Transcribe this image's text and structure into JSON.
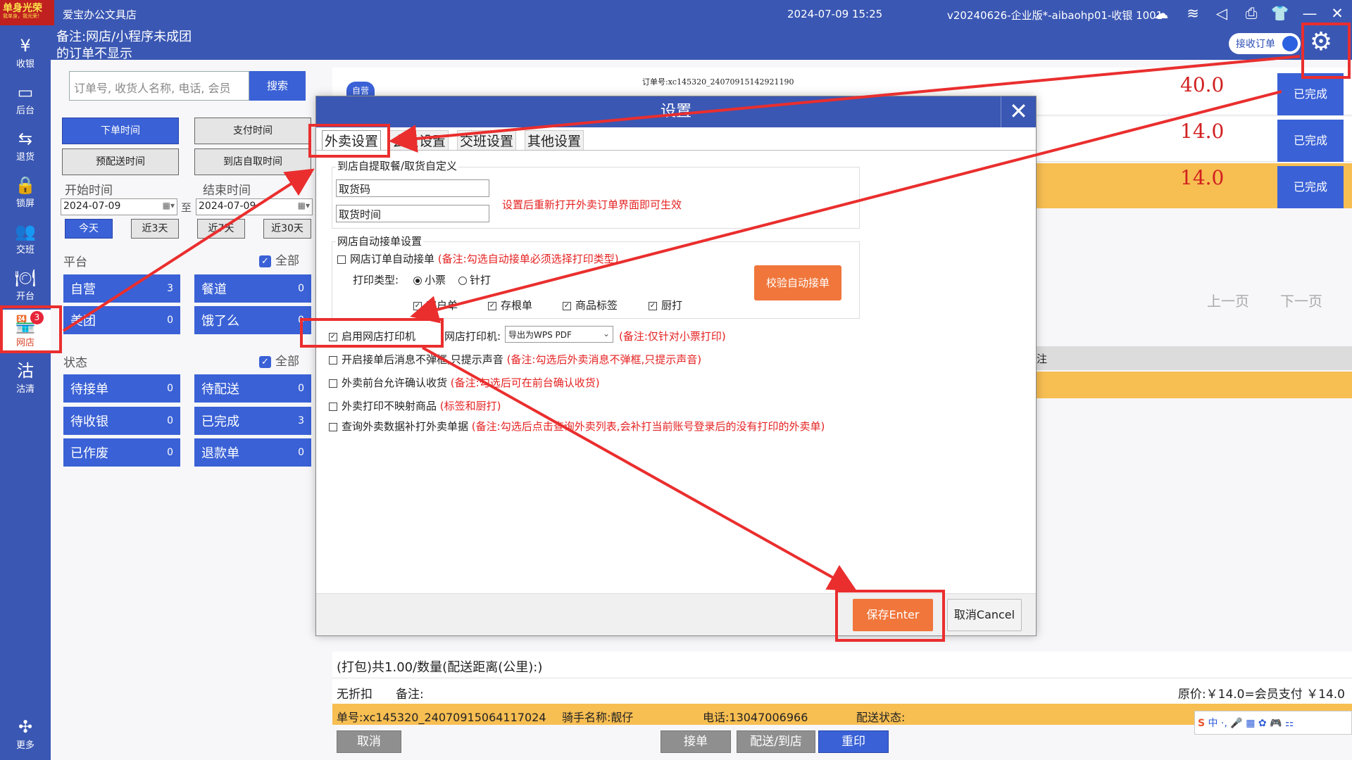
{
  "topbar": {
    "logo_main": "单身光荣",
    "logo_sub": "我单身，我光荣！",
    "store_name": "爱宝办公文具店",
    "datetime": "2024-07-09 15:25",
    "version": "v20240626-企业版*-aibaohp01-收银 1001",
    "note_line1": "备注:网店/小程序未成团",
    "note_line2": "的订单不显示",
    "toggle_label": "接收订单",
    "icons": [
      "cloud-icon",
      "wifi-icon",
      "speaker-icon",
      "printer-icon",
      "shirt-icon",
      "minimize-icon",
      "close-icon"
    ]
  },
  "sidebar": {
    "items": [
      {
        "label": "收银",
        "icon": "¥"
      },
      {
        "label": "后台",
        "icon": "▭"
      },
      {
        "label": "退货",
        "icon": "⇆"
      },
      {
        "label": "锁屏",
        "icon": "🔒"
      },
      {
        "label": "交班",
        "icon": "👥"
      },
      {
        "label": "开台",
        "icon": "🍽"
      },
      {
        "label": "网店",
        "icon": "🏪",
        "badge": "3"
      },
      {
        "label": "沽清",
        "icon": "沽"
      },
      {
        "label": "更多",
        "icon": "✣"
      }
    ]
  },
  "filters": {
    "search_placeholder": "订单号, 收货人名称, 电话, 会员",
    "search_button": "搜索",
    "time_buttons": [
      "下单时间",
      "支付时间",
      "预配送时间",
      "到店自取时间"
    ],
    "start_label": "开始时间",
    "end_label": "结束时间",
    "start_date": "2024-07-09",
    "to_label": "至",
    "end_date": "2024-07-09",
    "quick_ranges": [
      "今天",
      "近3天",
      "近7天",
      "近30天"
    ],
    "platform_label": "平台",
    "all_label": "全部",
    "platforms": [
      {
        "name": "自营",
        "count": "3"
      },
      {
        "name": "餐道",
        "count": "0"
      },
      {
        "name": "美团",
        "count": "0"
      },
      {
        "name": "饿了么",
        "count": "0"
      }
    ],
    "status_label": "状态",
    "statuses": [
      {
        "name": "待接单",
        "count": "0"
      },
      {
        "name": "待配送",
        "count": "0"
      },
      {
        "name": "待收银",
        "count": "0"
      },
      {
        "name": "已完成",
        "count": "3"
      },
      {
        "name": "已作废",
        "count": "0"
      },
      {
        "name": "退款单",
        "count": "0"
      }
    ]
  },
  "orders": {
    "first_order_no": "订单号:xc145320_24070915142921190",
    "first_tag": "自营",
    "rows": [
      {
        "price": "40.0",
        "status": "已完成"
      },
      {
        "price": "14.0",
        "status": "已完成"
      },
      {
        "price": "14.0",
        "status": "已完成"
      }
    ],
    "prev_page": "上一页",
    "next_page": "下一页",
    "col_fragment": "注"
  },
  "modal": {
    "title": "设置",
    "tabs": [
      "外卖设置",
      "会员设置",
      "交班设置",
      "其他设置"
    ],
    "pickup_group": "到店自提取餐/取货自定义",
    "pickup_code": "取货码",
    "pickup_time": "取货时间",
    "pickup_hint": "设置后重新打开外卖订单界面即可生效",
    "auto_group": "网店自动接单设置",
    "auto_accept": "网店订单自动接单",
    "auto_accept_note": "(备注:勾选自动接单必须选择打印类型)",
    "print_type_label": "打印类型:",
    "print_type_receipt": "小票",
    "print_type_dot": "针打",
    "receipt_options": [
      "客户单",
      "存根单",
      "商品标签",
      "厨打"
    ],
    "verify_button": "校验自动接单",
    "enable_printer": "启用网店打印机",
    "printer_label": "网店打印机:",
    "printer_value": "导出为WPS PDF",
    "printer_note": "(备注:仅针对小票打印)",
    "options": [
      {
        "label": "开启接单后消息不弹框,只提示声音",
        "note": "(备注:勾选后外卖消息不弹框,只提示声音)"
      },
      {
        "label": "外卖前台允许确认收货",
        "note": "(备注:勾选后可在前台确认收货)"
      },
      {
        "label": "外卖打印不映射商品",
        "note": "(标签和厨打)"
      },
      {
        "label": "查询外卖数据补打外卖单据",
        "note": "(备注:勾选后点击查询外卖列表,会补打当前账号登录后的没有打印的外卖单)"
      }
    ],
    "save_button": "保存Enter",
    "cancel_button": "取消Cancel"
  },
  "detail": {
    "pack_line": "(打包)共1.00/数量(配送距离(公里):)",
    "discount": "无折扣",
    "remark_label": "备注:",
    "price_line": "原价:￥14.0=会员支付 ￥14.0",
    "order_no": "单号:xc145320_24070915064117024",
    "rider": "骑手名称:靓仔",
    "phone": "电话:13047006966",
    "delivery_status": "配送状态:",
    "buttons": [
      "取消",
      "接单",
      "配送/到店",
      "重印"
    ],
    "ime_label": "中"
  }
}
